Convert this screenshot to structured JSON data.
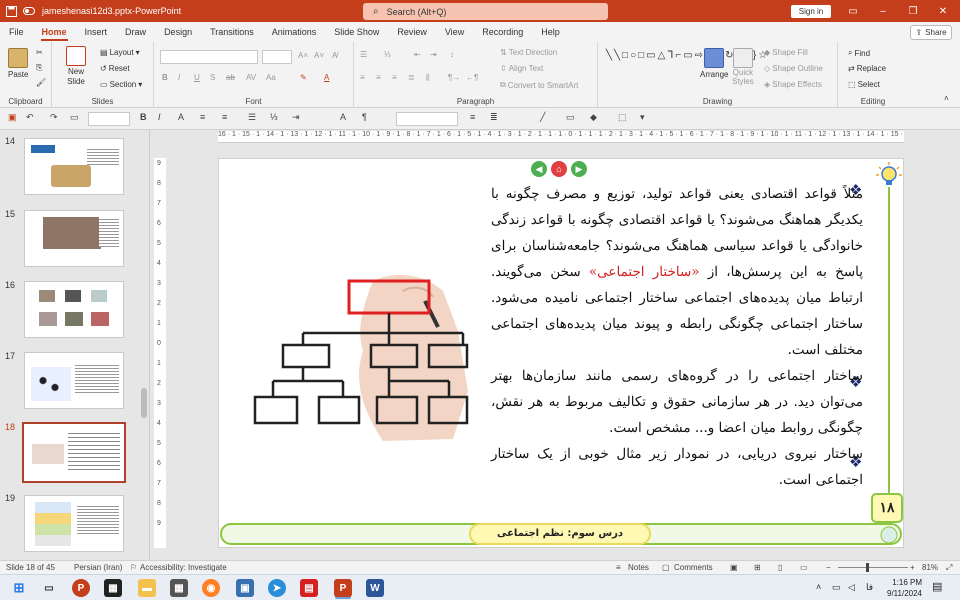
{
  "window": {
    "filename": "jameshenasi12d3.pptx",
    "app": "PowerPoint",
    "title_sep": " - ",
    "search_placeholder": "Search (Alt+Q)",
    "signin": "Sign in"
  },
  "menu": [
    "File",
    "Home",
    "Insert",
    "Draw",
    "Design",
    "Transitions",
    "Animations",
    "Slide Show",
    "Review",
    "View",
    "Recording",
    "Help"
  ],
  "share": "Share",
  "ribbon": {
    "groups": {
      "clipboard": "Clipboard",
      "slides": "Slides",
      "font": "Font",
      "paragraph": "Paragraph",
      "drawing": "Drawing",
      "editing": "Editing"
    },
    "paste": "Paste",
    "new_slide_line1": "New",
    "new_slide_line2": "Slide",
    "layout": "Layout",
    "reset": "Reset",
    "section": "Section",
    "text_direction": "Text Direction",
    "align_text": "Align Text",
    "convert_smartart": "Convert to SmartArt",
    "arrange": "Arrange",
    "quick_styles_line1": "Quick",
    "quick_styles_line2": "Styles",
    "shape_fill": "Shape Fill",
    "shape_outline": "Shape Outline",
    "shape_effects": "Shape Effects",
    "find": "Find",
    "replace": "Replace",
    "select": "Select"
  },
  "thumbnails": [
    {
      "num": "14",
      "selected": false
    },
    {
      "num": "15",
      "selected": false
    },
    {
      "num": "16",
      "selected": false
    },
    {
      "num": "17",
      "selected": false
    },
    {
      "num": "18",
      "selected": true
    },
    {
      "num": "19",
      "selected": false
    }
  ],
  "ruler_h": "16 · 1 · 15 · 1 · 14 · 1 · 13 · 1 · 12 · 1 · 11 · 1 · 10 · 1 · 9 · 1 · 8 · 1 · 7 · 1 · 6 · 1 · 5 · 1 · 4 · 1 · 3 · 1 · 2 · 1 · 1 · 1 · 0 · 1 · 1 · 1 · 2 · 1 · 3 · 1 · 4 · 1 · 5 · 1 · 6 · 1 · 7 · 1 · 8 · 1 · 9 · 1 · 10 · 1 · 11 · 1 · 12 · 1 · 13 · 1 · 14 · 1 · 15 · 1 · 16",
  "ruler_v": [
    "9",
    "8",
    "7",
    "6",
    "5",
    "4",
    "3",
    "2",
    "1",
    "0",
    "1",
    "2",
    "3",
    "4",
    "5",
    "6",
    "7",
    "8",
    "9"
  ],
  "slide": {
    "para1_a": "مثلاً قواعد اقتصادی یعنی قواعد تولید، توزیع و مصرف چگونه با یکدیگر هماهنگ می‌شوند؟ یا قواعد اقتصادی چگونه با قواعد زندگی خانوادگی یا قواعد سیاسی هماهنگ می‌شوند؟ جامعه‌شناسان برای پاسخ به این پرسش‌ها، از ",
    "para1_red": "«ساختار اجتماعی»",
    "para1_b": " سخن می‌گویند. ارتباط میان پدیده‌های اجتماعی ساختار اجتماعی نامیده می‌شود. ساختار اجتماعی چگونگی رابطه و پیوند میان پدیده‌های اجتماعی مختلف است.",
    "para2": "ساختار اجتماعی را در گروه‌های رسمی مانند سازمان‌ها بهتر می‌توان دید. در هر سازمانی حقوق و تکالیف مربوط به هر نقش، چگونگی روابط میان اعضا و... مشخص است.",
    "para3": "ساختار نیروی دریایی، در نمودار زیر مثال خوبی از یک ساختار اجتماعی است.",
    "bullet": "❖",
    "lesson": "درس سوم: نظم اجتماعی",
    "page_badge": "۱۸"
  },
  "status": {
    "slide_of": "Slide 18 of 45",
    "language": "Persian (Iran)",
    "accessibility": "Accessibility: Investigate",
    "notes": "Notes",
    "comments": "Comments",
    "zoom": "81%"
  },
  "taskbar": {
    "time": "1:16 PM",
    "date": "9/11/2024",
    "lang": "فا"
  },
  "colors": {
    "accent": "#c43e1c",
    "slide_border_green": "#8cc640",
    "lesson_fill": "#fff9b3",
    "bullet": "#1a2a6c",
    "red_text": "#d42020"
  }
}
